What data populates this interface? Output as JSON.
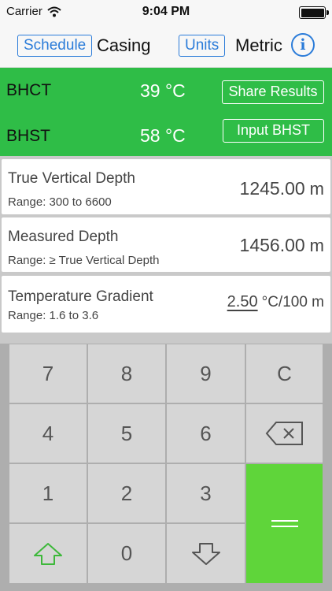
{
  "status_bar": {
    "carrier": "Carrier",
    "time": "9:04 PM"
  },
  "nav": {
    "schedule_button": "Schedule",
    "schedule_value": "Casing",
    "units_button": "Units",
    "units_value": "Metric",
    "info_glyph": "i"
  },
  "results": {
    "bhct_label": "BHCT",
    "bhct_value": "39 °C",
    "bhst_label": "BHST",
    "bhst_value": "58 °C",
    "share_button": "Share Results",
    "input_bhst_button": "Input BHST",
    "background_color": "#2fbd47"
  },
  "inputs": [
    {
      "name": "True Vertical Depth",
      "range": "Range: 300 to 6600",
      "value": "1245.00",
      "unit": "m"
    },
    {
      "name": "Measured Depth",
      "range": "Range: ≥ True Vertical Depth",
      "value": "1456.00",
      "unit": "m"
    },
    {
      "name": "Temperature  Gradient",
      "range": "Range: 1.6 to 3.6",
      "value": "2.50",
      "unit": "°C/100 m"
    }
  ],
  "keypad": {
    "keys": [
      "7",
      "8",
      "9",
      "C",
      "4",
      "5",
      "6",
      "1",
      "2",
      "3",
      "0"
    ],
    "icons": {
      "backspace": "backspace-icon",
      "up": "arrow-up-icon",
      "down": "arrow-down-icon",
      "enter": "equals-icon"
    },
    "accent_color": "#5fd53a"
  },
  "accent_color": "#2b7cd9"
}
